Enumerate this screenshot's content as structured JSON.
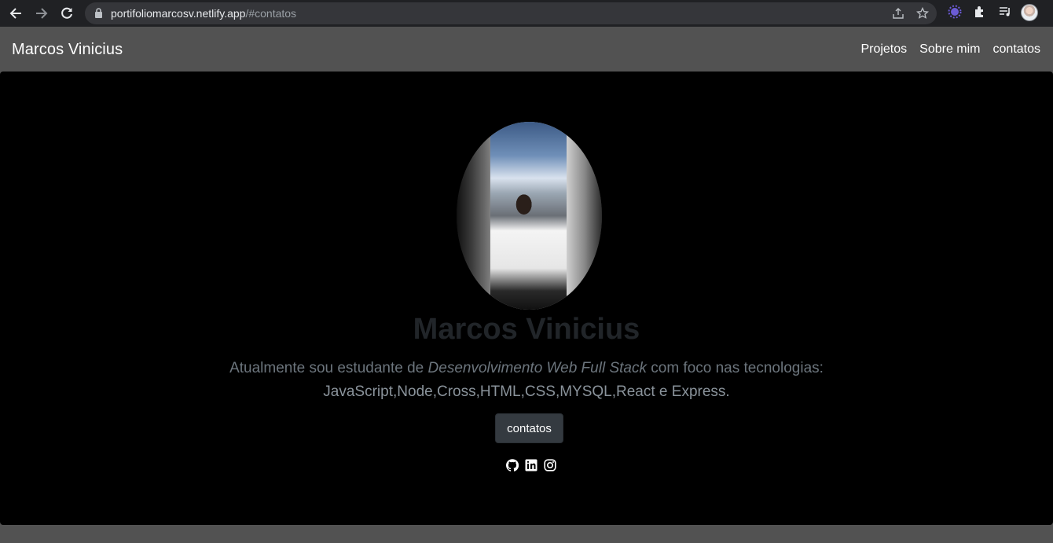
{
  "browser": {
    "url_host": "portifoliomarcosv.netlify.app",
    "url_path": "/#contatos"
  },
  "navbar": {
    "brand": "Marcos Vinicius",
    "links": [
      "Projetos",
      "Sobre mim",
      "contatos"
    ]
  },
  "hero": {
    "name": "Marcos Vinicius",
    "bio_prefix": "Atualmente sou estudante de ",
    "bio_emphasis": "Desenvolvimento Web Full Stack",
    "bio_suffix": " com foco nas tecnologias:",
    "bio_tech": "JavaScript,Node,Cross,HTML,CSS,MYSQL,React e Express.",
    "button_label": "contatos",
    "socials": [
      "github-icon",
      "linkedin-icon",
      "instagram-icon"
    ]
  },
  "colors": {
    "hero_bg": "#000000",
    "navbar_bg": "#525252",
    "button_bg": "#343a40"
  }
}
